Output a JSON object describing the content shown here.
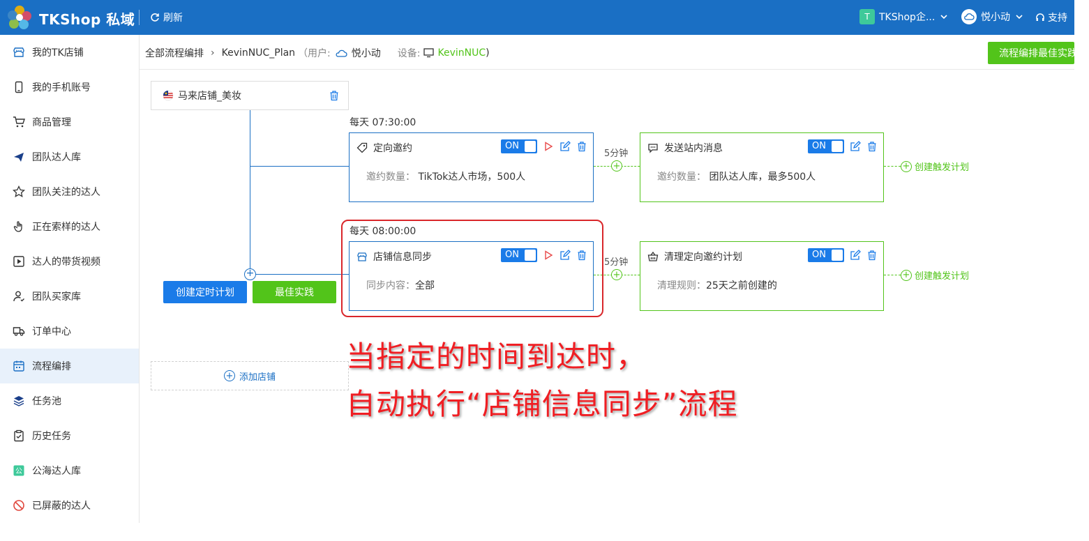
{
  "header": {
    "brand": "TKShop 私域",
    "refresh_label": "刷新",
    "team_initial": "T",
    "team_name": "TKShop企...",
    "user_name": "悦小动",
    "support_label": "支持"
  },
  "sidebar": {
    "items": [
      {
        "label": "我的TK店铺",
        "icon": "store-icon"
      },
      {
        "label": "我的手机账号",
        "icon": "phone-icon"
      },
      {
        "label": "商品管理",
        "icon": "cart-icon"
      },
      {
        "label": "团队达人库",
        "icon": "plane-icon"
      },
      {
        "label": "团队关注的达人",
        "icon": "star-icon"
      },
      {
        "label": "正在索样的达人",
        "icon": "hand-icon"
      },
      {
        "label": "达人的带货视频",
        "icon": "video-icon"
      },
      {
        "label": "团队买家库",
        "icon": "user-icon"
      },
      {
        "label": "订单中心",
        "icon": "truck-icon"
      },
      {
        "label": "流程编排",
        "icon": "calendar-icon",
        "active": true
      },
      {
        "label": "任务池",
        "icon": "layers-icon"
      },
      {
        "label": "历史任务",
        "icon": "clipboard-icon"
      },
      {
        "label": "公海达人库",
        "icon": "public-icon"
      },
      {
        "label": "已屏蔽的达人",
        "icon": "ban-icon"
      }
    ]
  },
  "breadcrumb": {
    "root": "全部流程编排",
    "plan": "KevinNUC_Plan",
    "user_prefix": "（用户:",
    "user_name": "悦小动",
    "device_prefix": "设备:",
    "device_name": "KevinNUC",
    "suffix": ")"
  },
  "top_button": "流程编排最佳实践",
  "shop": {
    "name": "马来店铺_美妆"
  },
  "flows": [
    {
      "schedule": "每天  07:30:00",
      "main": {
        "title": "定向邀约",
        "toggle": "ON",
        "body_label": "邀约数量：",
        "body_value": "TikTok达人市场，500人"
      },
      "gap": "5分钟",
      "next": {
        "title": "发送站内消息",
        "toggle": "ON",
        "body_label": "邀约数量：",
        "body_value": "团队达人库，最多500人"
      },
      "create_trigger": "创建触发计划"
    },
    {
      "schedule": "每天  08:00:00",
      "main": {
        "title": "店铺信息同步",
        "toggle": "ON",
        "body_label": "同步内容：",
        "body_value": "全部"
      },
      "gap": "5分钟",
      "next": {
        "title": "清理定向邀约计划",
        "toggle": "ON",
        "body_label": "清理规则：",
        "body_value": "25天之前创建的"
      },
      "create_trigger": "创建触发计划"
    }
  ],
  "buttons": {
    "create_schedule": "创建定时计划",
    "best_practice": "最佳实践"
  },
  "add_shop": "添加店铺",
  "annotation": {
    "line1": "当指定的时间到达时，",
    "line2": "自动执行“店铺信息同步”流程"
  },
  "colors": {
    "primary": "#1a6fc4",
    "accent_green": "#52c41a",
    "annotation_red": "#f01e23"
  }
}
